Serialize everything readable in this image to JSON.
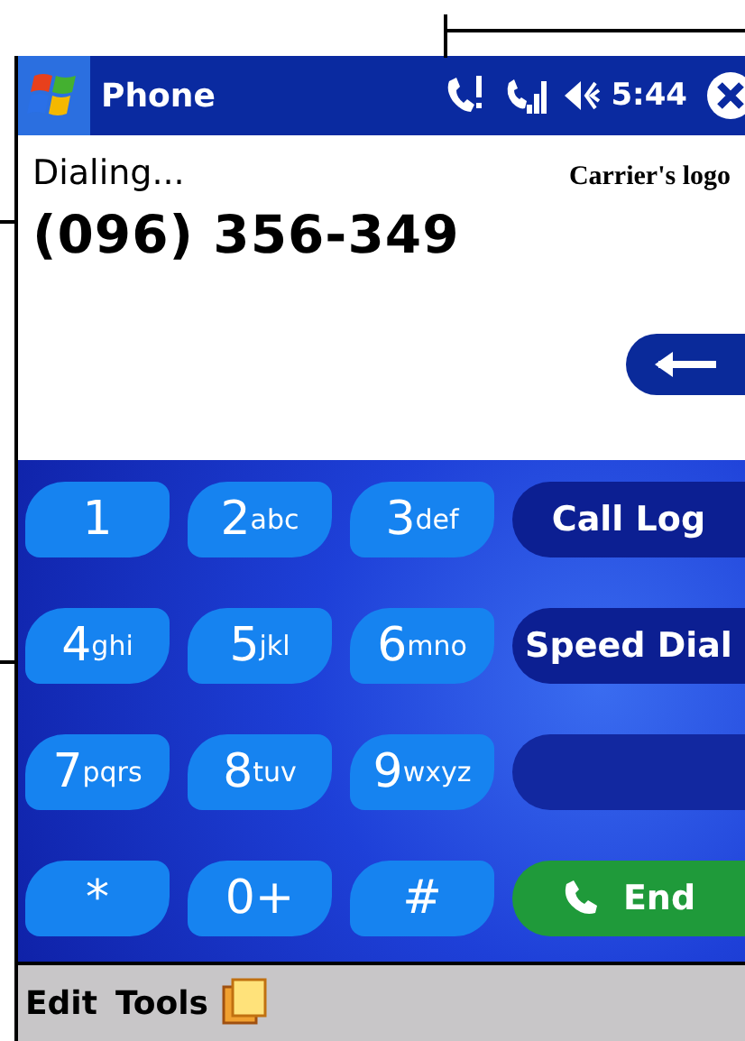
{
  "title_bar": {
    "title": "Phone",
    "time": "5:44"
  },
  "call": {
    "status": "Dialing...",
    "carrier": "Carrier's logo",
    "number": "(096) 356-349"
  },
  "keypad": [
    {
      "digit": "1"
    },
    {
      "digit": "2",
      "letters": "abc"
    },
    {
      "digit": "3",
      "letters": "def"
    },
    {
      "digit": "4",
      "letters": "ghi"
    },
    {
      "digit": "5",
      "letters": "jkl"
    },
    {
      "digit": "6",
      "letters": "mno"
    },
    {
      "digit": "7",
      "letters": "pqrs"
    },
    {
      "digit": "8",
      "letters": "tuv"
    },
    {
      "digit": "9",
      "letters": "wxyz"
    },
    {
      "digit": "*"
    },
    {
      "digit": "0+"
    },
    {
      "digit": "#"
    }
  ],
  "side_buttons": [
    {
      "kind": "plain",
      "label": "Call Log"
    },
    {
      "kind": "plain",
      "label": "Speed Dial"
    },
    {
      "kind": "empty"
    },
    {
      "kind": "end",
      "label": "End"
    }
  ],
  "menu_bar": [
    "Edit",
    "Tools"
  ]
}
